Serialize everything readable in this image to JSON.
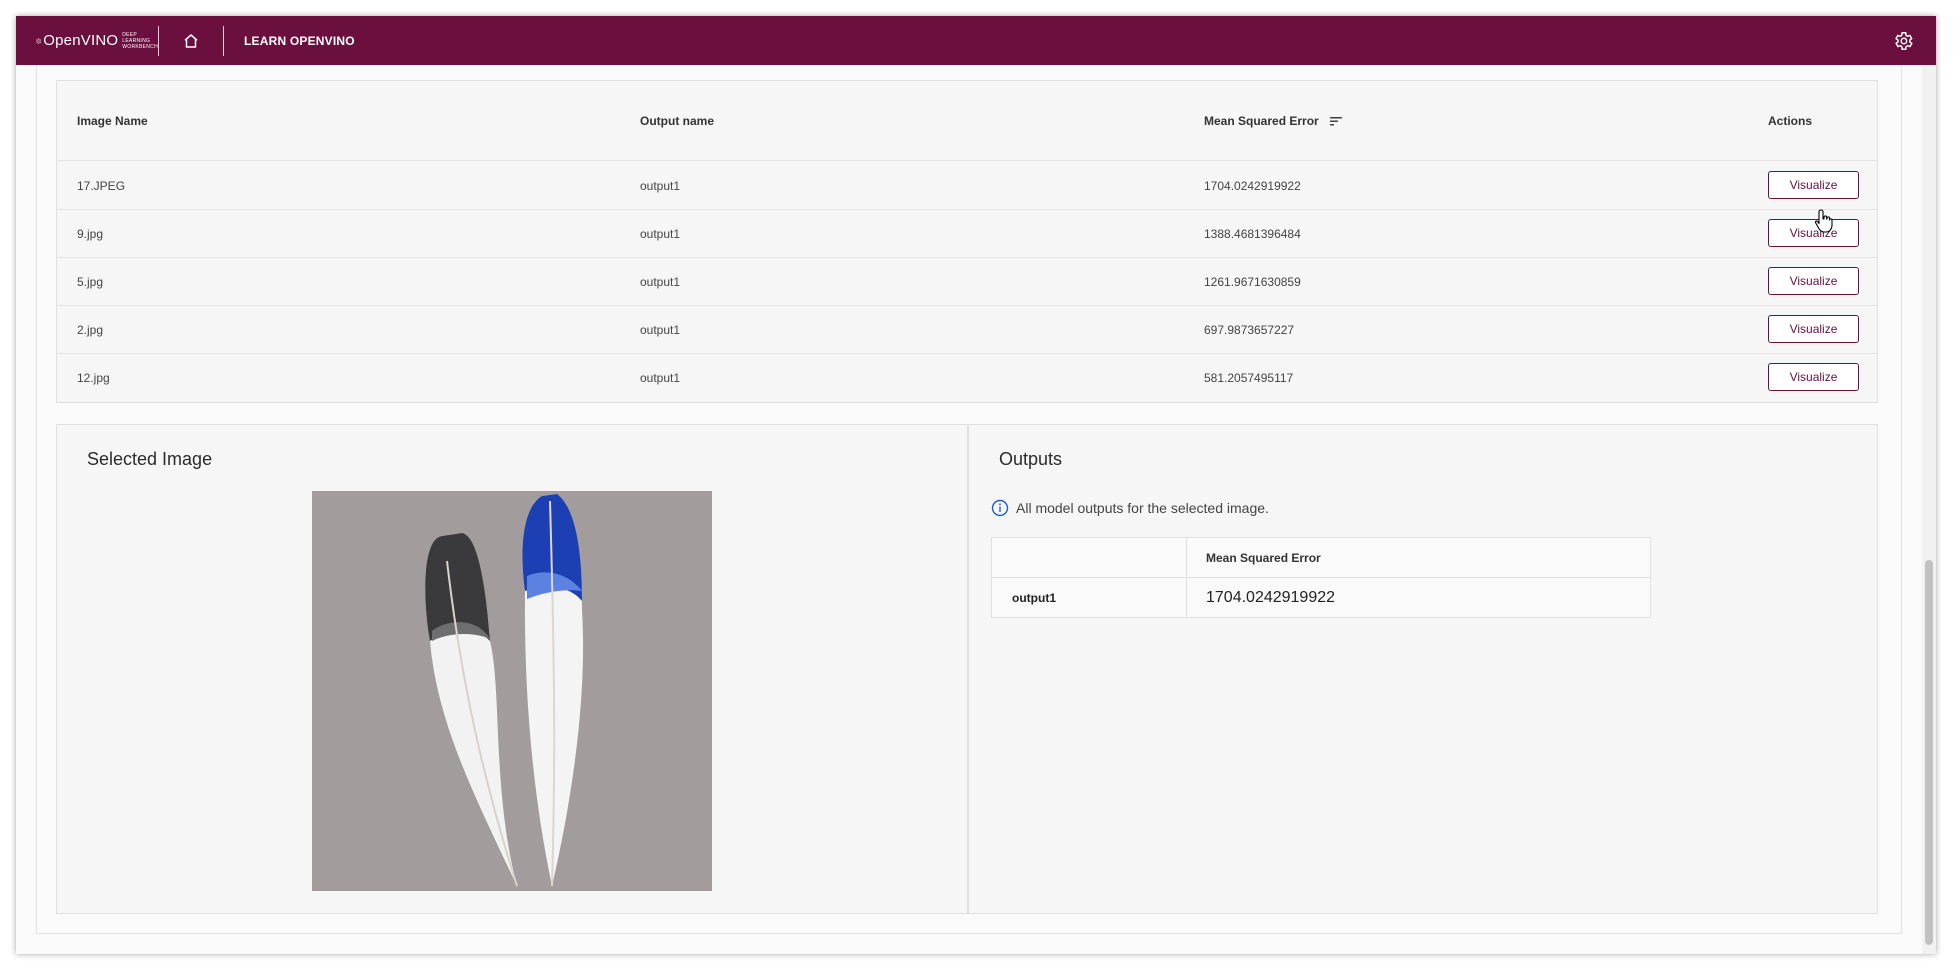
{
  "topbar": {
    "logo_text": "OpenVINO",
    "logo_sub_1": "DEEP LEARNING",
    "logo_sub_2": "WORKBENCH",
    "learn_label": "LEARN OPENVINO",
    "icons": [
      "openvino-logo-icon",
      "home-icon",
      "gear-icon"
    ],
    "color": "#6b0f3e"
  },
  "table": {
    "headers": {
      "image_name": "Image Name",
      "output_name": "Output name",
      "mse": "Mean Squared Error",
      "actions": "Actions"
    },
    "sort_icon": "sort-icon",
    "rows": [
      {
        "image": "17.JPEG",
        "output": "output1",
        "mse": "1704.0242919922",
        "action": "Visualize"
      },
      {
        "image": "9.jpg",
        "output": "output1",
        "mse": "1388.4681396484",
        "action": "Visualize"
      },
      {
        "image": "5.jpg",
        "output": "output1",
        "mse": "1261.9671630859",
        "action": "Visualize"
      },
      {
        "image": "2.jpg",
        "output": "output1",
        "mse": "697.9873657227",
        "action": "Visualize"
      },
      {
        "image": "12.jpg",
        "output": "output1",
        "mse": "581.2057495117",
        "action": "Visualize"
      }
    ]
  },
  "selected_image": {
    "title": "Selected Image",
    "image_desc": "two-feathers-image"
  },
  "outputs": {
    "title": "Outputs",
    "info_text": "All model outputs for the selected image.",
    "table": {
      "header_col2": "Mean Squared Error",
      "rows": [
        {
          "name": "output1",
          "mse": "1704.0242919922"
        }
      ]
    }
  }
}
